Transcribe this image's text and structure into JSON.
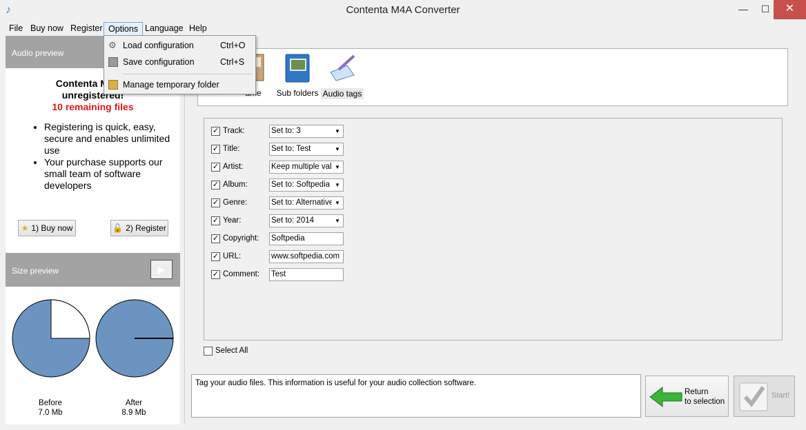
{
  "window": {
    "title": "Contenta M4A Converter",
    "min_glyph": "—",
    "max_glyph": "☐",
    "close_glyph": "✕"
  },
  "menubar": {
    "items": [
      "File",
      "Buy now",
      "Register",
      "Options",
      "Language",
      "Help"
    ]
  },
  "options_menu": {
    "items": [
      {
        "label": "Load configuration",
        "shortcut": "Ctrl+O",
        "icon": "gear-icon"
      },
      {
        "label": "Save configuration",
        "shortcut": "Ctrl+S",
        "icon": "save-icon"
      },
      {
        "label": "Manage temporary folder",
        "shortcut": "",
        "icon": "folder-icon"
      }
    ]
  },
  "audio_preview": {
    "header": "Audio preview",
    "title_line1": "Contenta M4A C",
    "title_line2": "unregistered!",
    "remaining": "10 remaining files",
    "bullets": [
      "Registering is quick, easy, secure and enables unlimited use",
      "Your purchase supports our small team of software developers"
    ],
    "buy_button": "1) Buy now",
    "register_button": "2) Register"
  },
  "size_preview": {
    "header": "Size preview",
    "before_label": "Before",
    "before_value": "7.0 Mb",
    "after_label": "After",
    "after_value": "8.9 Mb",
    "before_fraction_remaining": 0.25,
    "after_fraction_remaining": 0.0
  },
  "toolbar": {
    "items": [
      {
        "label": "ame",
        "icon": "filename-icon"
      },
      {
        "label": "Sub folders",
        "icon": "subfolders-icon"
      },
      {
        "label": "Audio tags",
        "icon": "audio-tags-icon"
      }
    ]
  },
  "tags": [
    {
      "label": "Track:",
      "value": "Set to: 3",
      "combo": true,
      "checked": true
    },
    {
      "label": "Title:",
      "value": "Set to: Test",
      "combo": true,
      "checked": true
    },
    {
      "label": "Artist:",
      "value": "Keep multiple valu",
      "combo": true,
      "checked": true
    },
    {
      "label": "Album:",
      "value": "Set to: Softpedia",
      "combo": true,
      "checked": true
    },
    {
      "label": "Genre:",
      "value": "Set to: Alternative",
      "combo": true,
      "checked": true
    },
    {
      "label": "Year:",
      "value": "Set to: 2014",
      "combo": true,
      "checked": true
    },
    {
      "label": "Copyright:",
      "value": "Softpedia",
      "combo": false,
      "checked": true
    },
    {
      "label": "URL:",
      "value": "www.softpedia.com",
      "combo": false,
      "checked": true
    },
    {
      "label": "Comment:",
      "value": "Test",
      "combo": false,
      "checked": true
    }
  ],
  "select_all": "Select All",
  "status_text": "Tag your audio files. This information is useful for your audio collection software.",
  "return_button": {
    "line1": "Return",
    "line2": "to selection"
  },
  "start_button": "Start!",
  "colors": {
    "pie_fill": "#6b95c0",
    "remaining_red": "#e01818",
    "panel_header": "#a3a3a3",
    "close_button": "#c7504c"
  }
}
